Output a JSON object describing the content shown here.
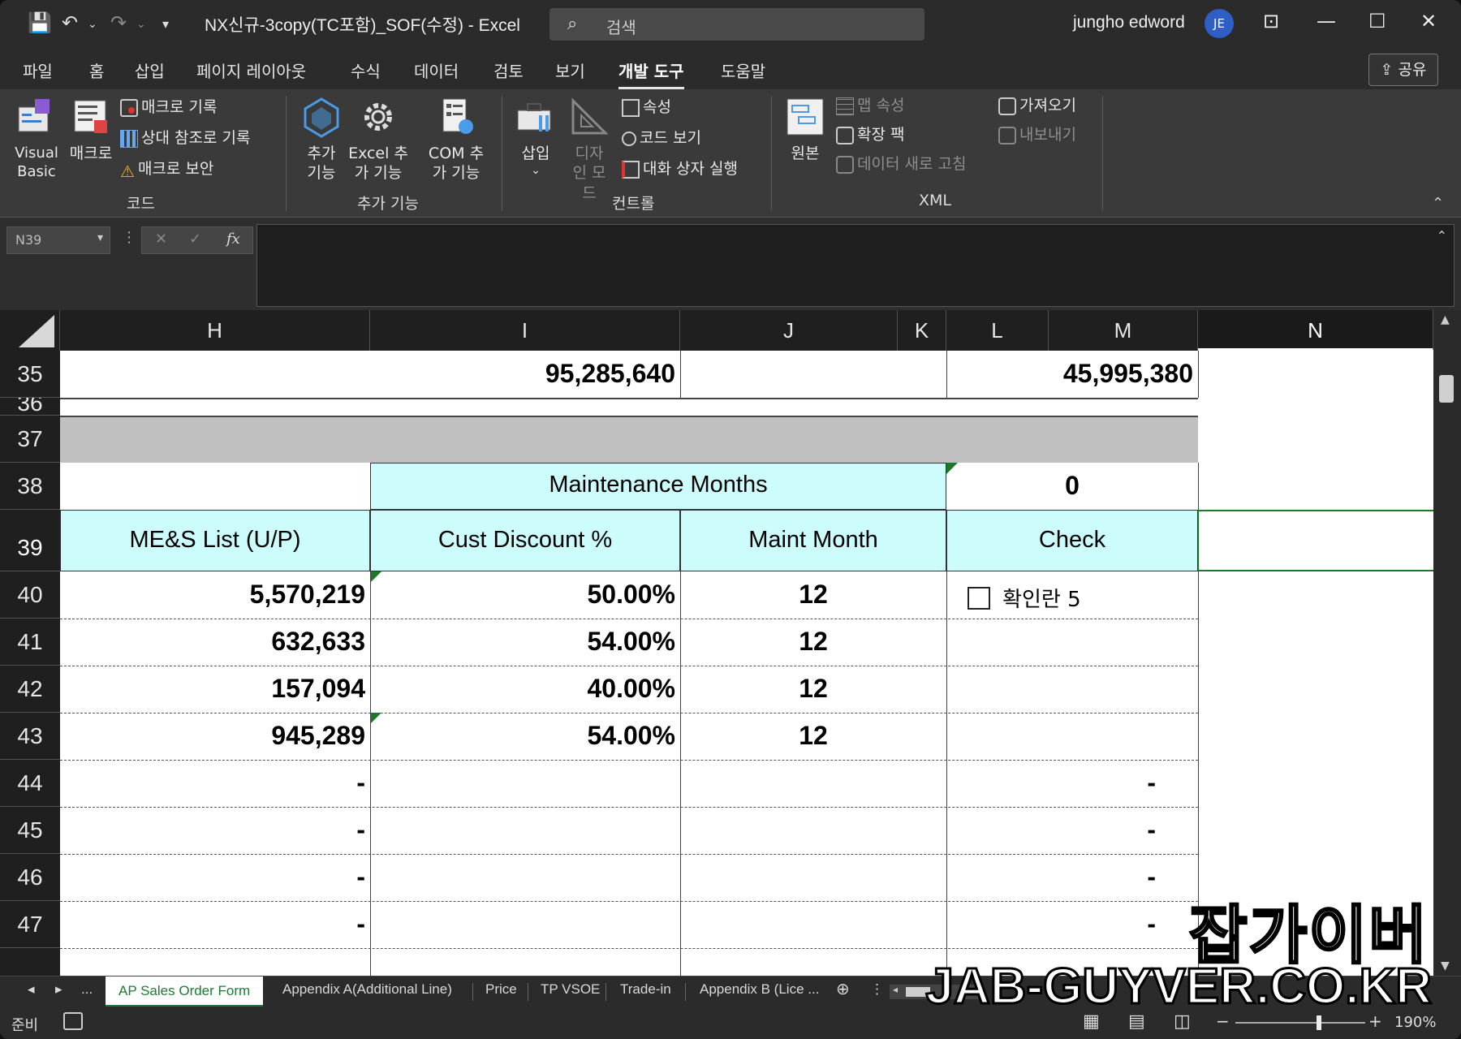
{
  "titlebar": {
    "doc_title": "NX신규-3copy(TC포함)_SOF(수정)  -  Excel",
    "search_placeholder": "검색",
    "user_name": "jungho edword",
    "avatar_initials": "JE"
  },
  "ribbon_tabs": [
    {
      "label": "파일"
    },
    {
      "label": "홈"
    },
    {
      "label": "삽입"
    },
    {
      "label": "페이지 레이아웃"
    },
    {
      "label": "수식"
    },
    {
      "label": "데이터"
    },
    {
      "label": "검토"
    },
    {
      "label": "보기"
    },
    {
      "label": "개발 도구",
      "active": true
    },
    {
      "label": "도움말"
    }
  ],
  "share_label": "공유",
  "ribbon": {
    "code": {
      "label": "코드",
      "visual_basic": "Visual Basic",
      "macro": "매크로",
      "record_macro": "매크로 기록",
      "relative_ref": "상대 참조로 기록",
      "macro_security": "매크로 보안"
    },
    "addins": {
      "label": "추가 기능",
      "addins": "추가 기능",
      "excel_addins": "Excel 추가 기능",
      "com_addins": "COM 추가 기능"
    },
    "controls": {
      "label": "컨트롤",
      "insert": "삽입",
      "design_mode": "디자인 모드",
      "properties": "속성",
      "view_code": "코드 보기",
      "run_dialog": "대화 상자 실행"
    },
    "xml": {
      "label": "XML",
      "source": "원본",
      "map_properties": "맵 속성",
      "expansion_packs": "확장 팩",
      "refresh_data": "데이터 새로 고침",
      "import": "가져오기",
      "export": "내보내기"
    }
  },
  "formula_bar": {
    "name_box": "N39",
    "fx": "fx",
    "value": ""
  },
  "columns": [
    "H",
    "I",
    "J",
    "K",
    "L",
    "M",
    "N"
  ],
  "selected_column": "N",
  "rows": [
    "35",
    "36",
    "37",
    "38",
    "39",
    "40",
    "41",
    "42",
    "43",
    "44",
    "45",
    "46",
    "47"
  ],
  "cells": {
    "r35_i": "95,285,640",
    "r35_m": "45,995,380",
    "r38_label": "Maintenance Months",
    "r38_value": "0",
    "hdr_mes": "ME&S List (U/P)",
    "hdr_disc": "Cust Discount %",
    "hdr_maint": "Maint Month",
    "hdr_check": "Check",
    "data": [
      {
        "mes": "5,570,219",
        "disc": "50.00%",
        "maint": "12"
      },
      {
        "mes": "632,633",
        "disc": "54.00%",
        "maint": "12"
      },
      {
        "mes": "157,094",
        "disc": "40.00%",
        "maint": "12"
      },
      {
        "mes": "945,289",
        "disc": "54.00%",
        "maint": "12"
      }
    ],
    "dash_rows": [
      "-",
      "-",
      "-",
      "-"
    ],
    "checkbox_label": "확인란 5"
  },
  "sheet_tabs": [
    {
      "label": "AP Sales Order Form",
      "active": true
    },
    {
      "label": "Appendix A(Additional Line)"
    },
    {
      "label": "Price"
    },
    {
      "label": "TP VSOE"
    },
    {
      "label": "Trade-in"
    },
    {
      "label": "Appendix B (Lice ..."
    }
  ],
  "sheet_nav_ellipsis": "...",
  "status": {
    "ready": "준비",
    "zoom": "190%"
  },
  "watermark": {
    "korean": "잡가이버",
    "english": "JAB-GUYVER.CO.KR"
  },
  "colors": {
    "header_fill": "#ccfcfc",
    "band_gray": "#c0c0c0",
    "active_tab": "#1e7a34"
  }
}
